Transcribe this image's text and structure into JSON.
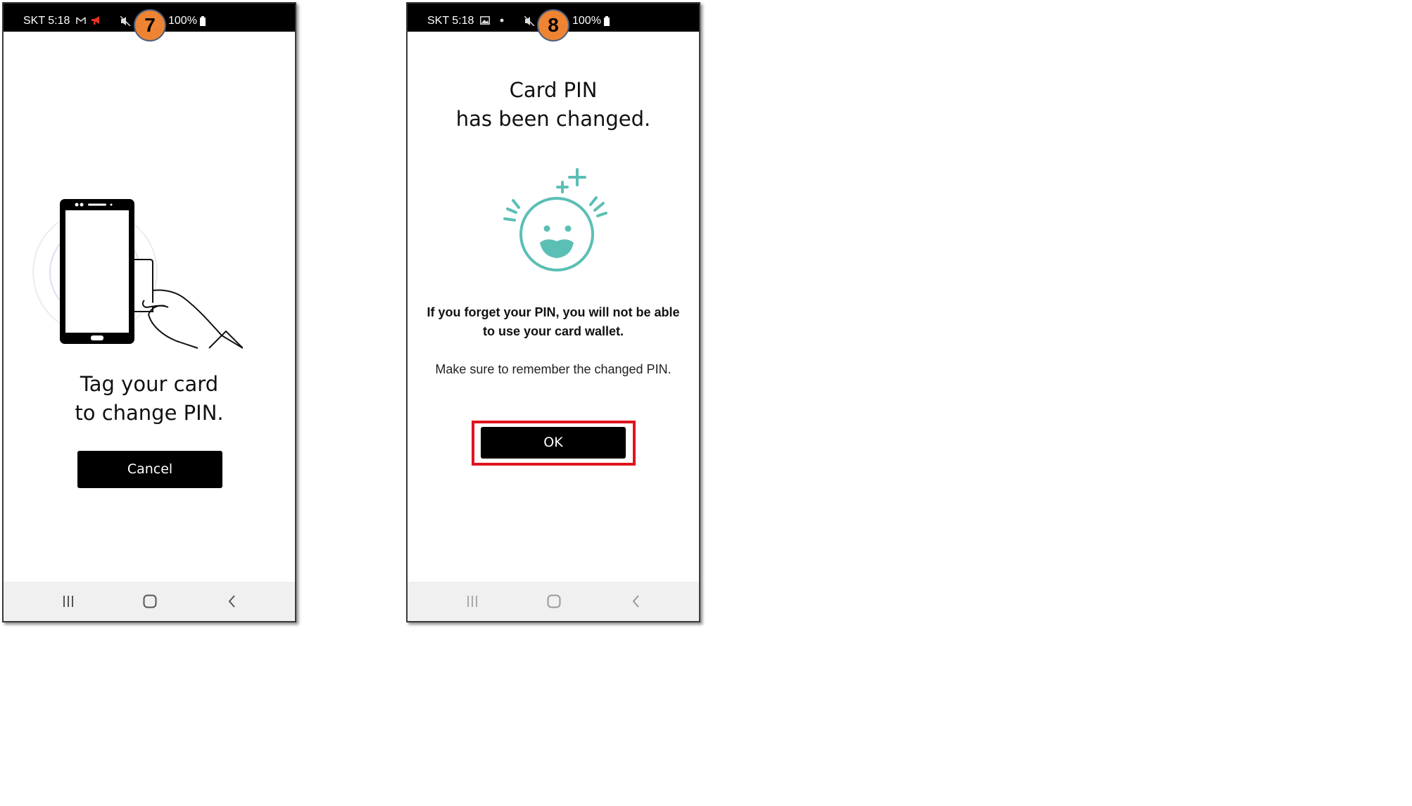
{
  "screens": [
    {
      "step": "7",
      "status": {
        "carrier_time": "SKT 5:18",
        "battery": "100%"
      },
      "title_line1": "Tag your card",
      "title_line2": "to change PIN.",
      "cancel_label": "Cancel",
      "icons": [
        "gmail-icon",
        "megaphone-icon",
        "mute-icon",
        "battery-icon",
        "phone-tag-card-illustration"
      ]
    },
    {
      "step": "8",
      "status": {
        "carrier_time": "SKT 5:18",
        "battery": "100%"
      },
      "title_line1": "Card PIN",
      "title_line2": "has been changed.",
      "warning": "If you forget your PIN, you will not be able to use your card wallet.",
      "note": "Make sure to remember the changed PIN.",
      "ok_label": "OK",
      "accent_color": "#5bbfb5",
      "highlight_color": "#e0141f",
      "icons": [
        "gallery-icon",
        "dot-icon",
        "mute-icon",
        "battery-icon",
        "smiley-icon"
      ]
    }
  ],
  "nav_icons": [
    "recent-apps-icon",
    "home-icon",
    "back-icon"
  ],
  "badge_color": "#ee8433"
}
